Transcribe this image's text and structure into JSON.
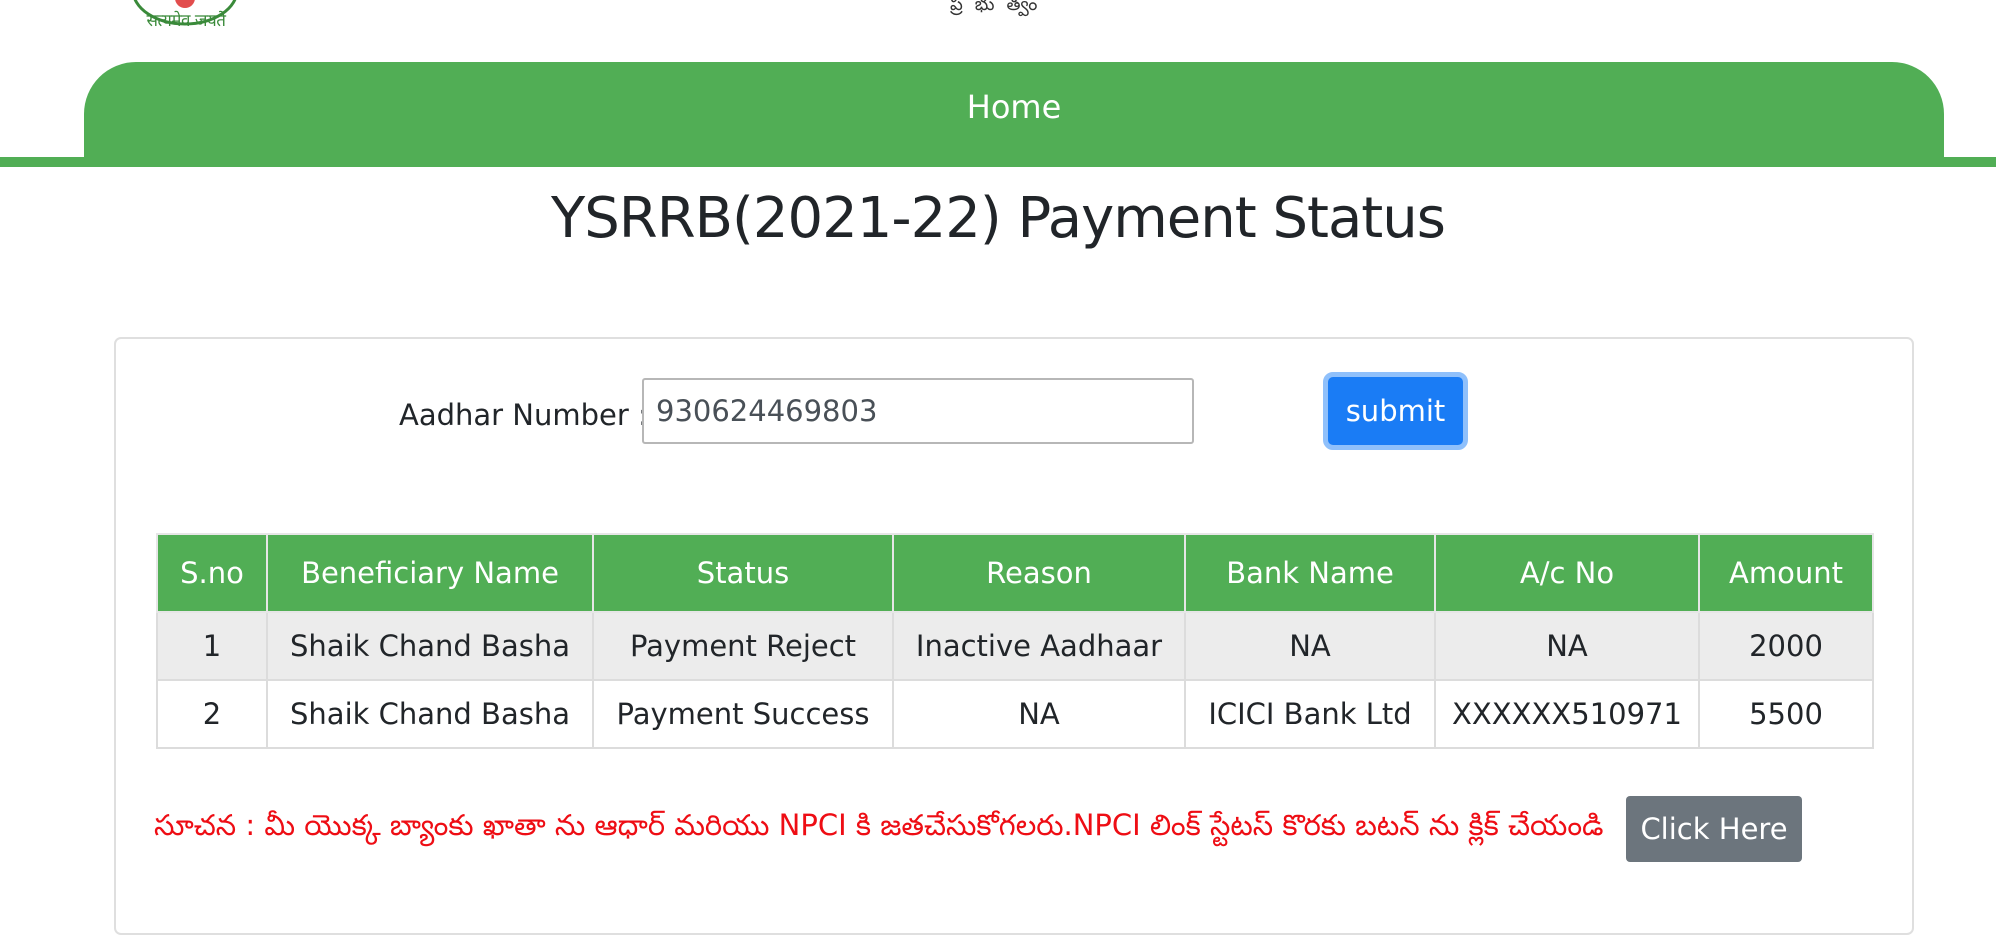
{
  "header": {
    "emblem_motto": "सत्यमेव जयते",
    "cut_text": "ప్రభుత్వం"
  },
  "nav": {
    "home_label": "Home"
  },
  "page": {
    "title": "YSRRB(2021-22) Payment Status"
  },
  "search": {
    "label": "Aadhar Number :",
    "value": "930624469803",
    "submit_label": "submit"
  },
  "table": {
    "headers": [
      "S.no",
      "Beneficiary Name",
      "Status",
      "Reason",
      "Bank Name",
      "A/c No",
      "Amount"
    ],
    "rows": [
      [
        "1",
        "Shaik Chand Basha",
        "Payment Reject",
        "Inactive Aadhaar",
        "NA",
        "NA",
        "2000"
      ],
      [
        "2",
        "Shaik Chand Basha",
        "Payment Success",
        "NA",
        "ICICI Bank Ltd",
        "XXXXXX510971",
        "5500"
      ]
    ]
  },
  "notice": {
    "text": "సూచన : మీ యొక్క బ్యాంకు ఖాతా ను ఆధార్ మరియు NPCI కి జతచేసుకోగలరు.NPCI లింక్ స్టేటస్ కొరకు బటన్ ను క్లిక్ చేయండి",
    "button_label": "Click Here"
  },
  "colors": {
    "nav_green": "#51ae55",
    "submit_blue": "#1a7cf5",
    "notice_red": "#ee0d14",
    "button_gray": "#6c757d"
  }
}
